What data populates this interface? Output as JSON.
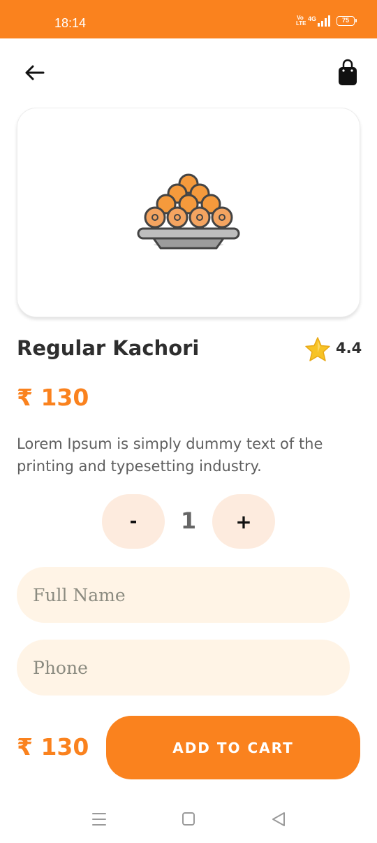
{
  "status_bar": {
    "time": "18:14",
    "volte_label": "Vo\nLTE",
    "network_label": "4G",
    "battery_level": "75",
    "background_color": "#fa821e"
  },
  "header": {
    "back_icon": "arrow-left-icon",
    "cart_icon": "shopping-bag-icon"
  },
  "product": {
    "image_icon": "sweets-platter-icon",
    "name": "Regular Kachori",
    "rating": "4.4",
    "rating_icon": "star-icon",
    "price": "₹ 130",
    "description": "Lorem Ipsum is simply dummy text of the printing and typesetting industry."
  },
  "quantity": {
    "minus_label": "-",
    "value": "1",
    "plus_label": "+"
  },
  "form": {
    "full_name_placeholder": "Full Name",
    "full_name_value": "",
    "phone_placeholder": "Phone",
    "phone_value": ""
  },
  "footer": {
    "total_price": "₹ 130",
    "add_to_cart_label": "ADD TO CART"
  },
  "nav_bar": {
    "menu_icon": "recent-apps-icon",
    "home_icon": "home-square-icon",
    "back_icon": "back-triangle-icon"
  },
  "colors": {
    "accent": "#fa821e",
    "quantity_button_bg": "#fdebde",
    "field_bg": "#fff4e6",
    "text_dark": "#2e2e2e",
    "text_muted": "#5f5f5f"
  }
}
